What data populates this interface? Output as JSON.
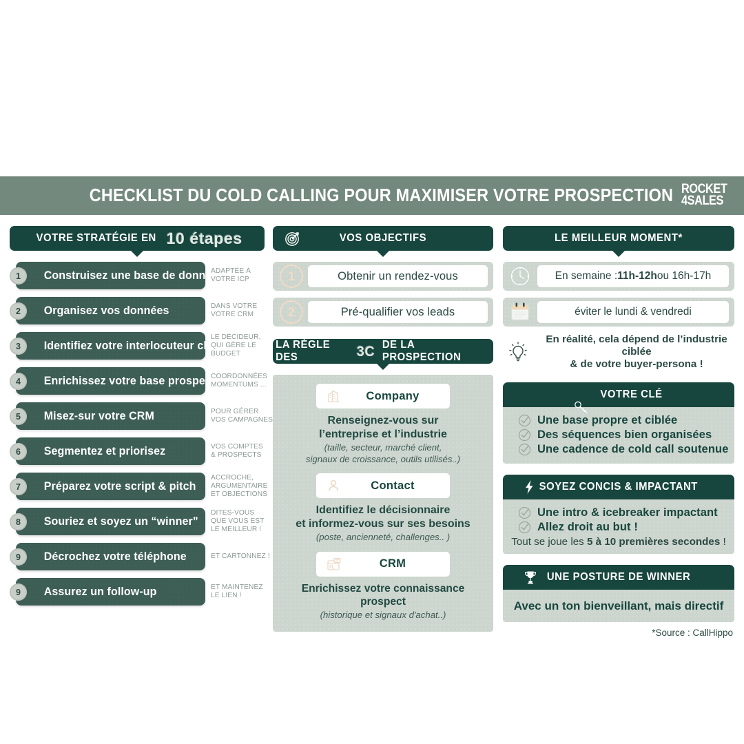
{
  "header": {
    "title": "CHECKLIST DU COLD CALLING POUR MAXIMISER VOTRE PROSPECTION",
    "logo_line1": "ROCKET",
    "logo_line2": "4SALES",
    "bar_color": "#74897d"
  },
  "colors": {
    "dark_green": "#17463e",
    "card_green": "#3d5e55",
    "panel_sage": "#ccd5ce",
    "beige": "#f0dcc6",
    "note_gray": "#8c9a93"
  },
  "left": {
    "header_prefix": "VOTRE STRATÉGIE EN",
    "header_script": "10 étapes",
    "steps": [
      {
        "num": "1",
        "label": "Construisez une base de données",
        "note": "ADAPTÉE À\nVOTRE ICP"
      },
      {
        "num": "2",
        "label": "Organisez vos données",
        "note": "DANS VOTRE\nVOTRE CRM"
      },
      {
        "num": "3",
        "label": "Identifiez votre interlocuteur clé",
        "note": "LE DÉCIDEUR,\nQUI GÈRE LE\nBUDGET"
      },
      {
        "num": "4",
        "label": "Enrichissez votre base prospects",
        "note": "COORDONNÉES\nMOMENTUMS ..."
      },
      {
        "num": "5",
        "label": "Misez-sur votre CRM",
        "note": "POUR GÉRER\nVOS CAMPAGNES"
      },
      {
        "num": "6",
        "label": "Segmentez et priorisez",
        "note": "VOS COMPTES\n& PROSPECTS"
      },
      {
        "num": "7",
        "label": "Préparez votre script & pitch",
        "note": "ACCROCHE,\nARGUMENTAIRE\nET OBJECTIONS"
      },
      {
        "num": "8",
        "label": "Souriez et soyez un “winner”",
        "note": "DITES-VOUS\nQUE VOUS EST\nLE MEILLEUR !"
      },
      {
        "num": "9",
        "label": "Décrochez votre téléphone",
        "note": "ET CARTONNEZ !"
      },
      {
        "num": "9",
        "label": "Assurez un follow-up",
        "note": "ET MAINTENEZ\nLE LIEN !"
      }
    ]
  },
  "middle": {
    "objectives_header": "VOS OBJECTIFS",
    "objectives": [
      {
        "num": "1",
        "label": "Obtenir un rendez-vous"
      },
      {
        "num": "2",
        "label": "Pré-qualifier vos leads"
      }
    ],
    "rule_header_before": "LA RÈGLE DES",
    "rule_header_3c": "3C",
    "rule_header_after": "DE LA PROSPECTION",
    "rule_items": [
      {
        "chip": "Company",
        "icon": "building-icon",
        "main": "Renseignez-vous sur\nl’entreprise et l’industrie",
        "sub": "(taille, secteur, marché client,\nsignaux de croissance, outils utilisés..)"
      },
      {
        "chip": "Contact",
        "icon": "person-icon",
        "main": "Identifiez le décisionnaire\net informez-vous sur ses besoins",
        "sub": "(poste, ancienneté, challenges.. )"
      },
      {
        "chip": "CRM",
        "icon": "crm-icon",
        "main": "Enrichissez votre connaissance prospect",
        "sub": "(historique et signaux d'achat..)"
      }
    ]
  },
  "right": {
    "moment_header": "LE MEILLEUR MOMENT*",
    "moment_rows": [
      {
        "icon": "clock-icon",
        "prefix": "En semaine : ",
        "strong": "11h-12h",
        "suffix": " ou 16h-17h"
      },
      {
        "icon": "calendar-icon",
        "prefix": "éviter le lundi & vendredi",
        "strong": "",
        "suffix": ""
      }
    ],
    "moment_note_icon": "lightbulb-icon",
    "moment_note": "En réalité, cela dépend de l’industrie ciblée\n& de votre buyer-persona  !",
    "key_header": "VOTRE CLÉ",
    "key_icon": "key-icon",
    "key_items": [
      "Une base propre et ciblée",
      "Des séquences bien organisées",
      "Une cadence de cold call soutenue"
    ],
    "concis_header": "SOYEZ CONCIS & IMPACTANT",
    "concis_icon": "bolt-icon",
    "concis_items": [
      "Une intro & icebreaker impactant",
      "Allez droit au but !"
    ],
    "concis_foot_prefix": "Tout se joue les ",
    "concis_foot_strong": "5 à 10 premières secondes",
    "concis_foot_suffix": " !",
    "winner_header": "UNE POSTURE DE WINNER",
    "winner_icon": "trophy-icon",
    "winner_text": "Avec un ton bienveillant, mais directif",
    "source": "*Source : CallHippo"
  }
}
